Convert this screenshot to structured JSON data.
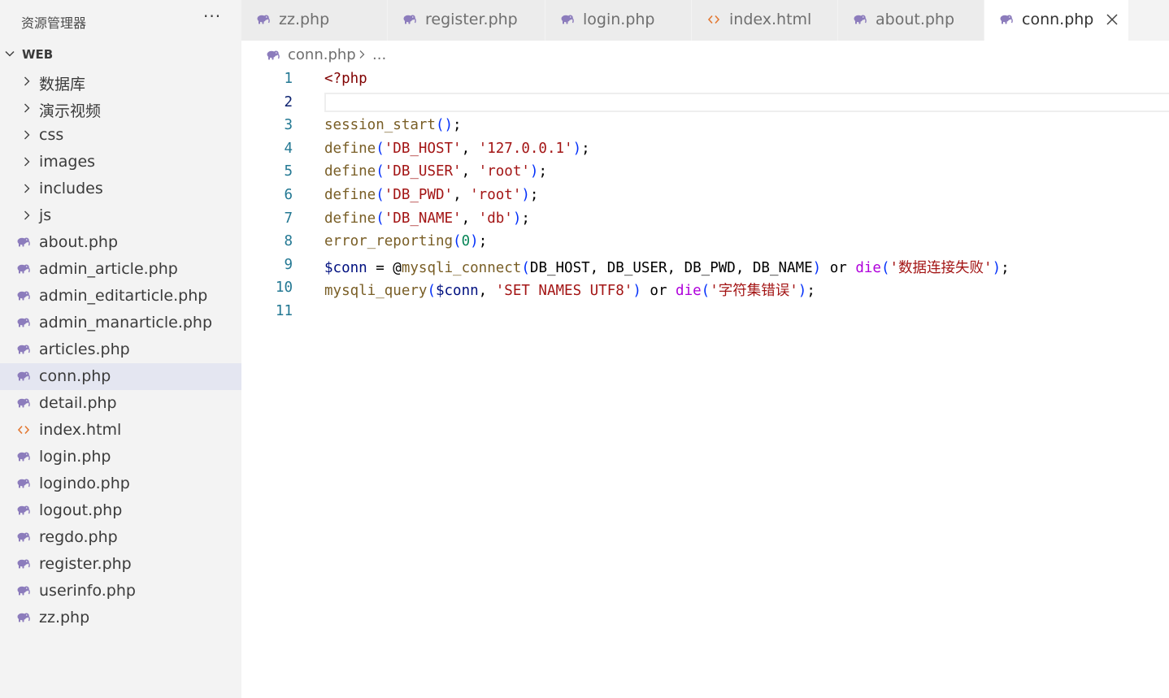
{
  "explorer": {
    "title": "资源管理器",
    "more_label": "···",
    "root": {
      "label": "WEB",
      "expanded": true
    },
    "items": [
      {
        "type": "folder",
        "label": "数据库"
      },
      {
        "type": "folder",
        "label": "演示视频"
      },
      {
        "type": "folder",
        "label": "css"
      },
      {
        "type": "folder",
        "label": "images"
      },
      {
        "type": "folder",
        "label": "includes"
      },
      {
        "type": "folder",
        "label": "js"
      },
      {
        "type": "php",
        "label": "about.php"
      },
      {
        "type": "php",
        "label": "admin_article.php"
      },
      {
        "type": "php",
        "label": "admin_editarticle.php"
      },
      {
        "type": "php",
        "label": "admin_manarticle.php"
      },
      {
        "type": "php",
        "label": "articles.php"
      },
      {
        "type": "php",
        "label": "conn.php",
        "selected": true
      },
      {
        "type": "php",
        "label": "detail.php"
      },
      {
        "type": "html",
        "label": "index.html"
      },
      {
        "type": "php",
        "label": "login.php"
      },
      {
        "type": "php",
        "label": "logindo.php"
      },
      {
        "type": "php",
        "label": "logout.php"
      },
      {
        "type": "php",
        "label": "regdo.php"
      },
      {
        "type": "php",
        "label": "register.php"
      },
      {
        "type": "php",
        "label": "userinfo.php"
      },
      {
        "type": "php",
        "label": "zz.php"
      }
    ]
  },
  "tabs": [
    {
      "label": "zz.php",
      "type": "php"
    },
    {
      "label": "register.php",
      "type": "php"
    },
    {
      "label": "login.php",
      "type": "php"
    },
    {
      "label": "index.html",
      "type": "html"
    },
    {
      "label": "about.php",
      "type": "php"
    },
    {
      "label": "conn.php",
      "type": "php",
      "active": true
    }
  ],
  "breadcrumb": {
    "file": "conn.php",
    "more": "..."
  },
  "editor": {
    "current_line": 2,
    "lines": [
      {
        "n": "1",
        "tokens": [
          [
            "kw",
            "<?php"
          ]
        ]
      },
      {
        "n": "2",
        "tokens": []
      },
      {
        "n": "3",
        "tokens": [
          [
            "fn",
            "session_start"
          ],
          [
            "par",
            "()"
          ],
          [
            "pun",
            ";"
          ]
        ]
      },
      {
        "n": "4",
        "tokens": [
          [
            "fn",
            "define"
          ],
          [
            "par",
            "("
          ],
          [
            "str",
            "'DB_HOST'"
          ],
          [
            "pun",
            ", "
          ],
          [
            "str",
            "'127.0.0.1'"
          ],
          [
            "par",
            ")"
          ],
          [
            "pun",
            ";"
          ]
        ]
      },
      {
        "n": "5",
        "tokens": [
          [
            "fn",
            "define"
          ],
          [
            "par",
            "("
          ],
          [
            "str",
            "'DB_USER'"
          ],
          [
            "pun",
            ", "
          ],
          [
            "str",
            "'root'"
          ],
          [
            "par",
            ")"
          ],
          [
            "pun",
            ";"
          ]
        ]
      },
      {
        "n": "6",
        "tokens": [
          [
            "fn",
            "define"
          ],
          [
            "par",
            "("
          ],
          [
            "str",
            "'DB_PWD'"
          ],
          [
            "pun",
            ", "
          ],
          [
            "str",
            "'root'"
          ],
          [
            "par",
            ")"
          ],
          [
            "pun",
            ";"
          ]
        ]
      },
      {
        "n": "7",
        "tokens": [
          [
            "fn",
            "define"
          ],
          [
            "par",
            "("
          ],
          [
            "str",
            "'DB_NAME'"
          ],
          [
            "pun",
            ", "
          ],
          [
            "str",
            "'db'"
          ],
          [
            "par",
            ")"
          ],
          [
            "pun",
            ";"
          ]
        ]
      },
      {
        "n": "8",
        "tokens": [
          [
            "fn",
            "error_reporting"
          ],
          [
            "par",
            "("
          ],
          [
            "num",
            "0"
          ],
          [
            "par",
            ")"
          ],
          [
            "pun",
            ";"
          ]
        ]
      },
      {
        "n": "9",
        "tokens": [
          [
            "var",
            "$conn"
          ],
          [
            "op",
            " = "
          ],
          [
            "op",
            "@"
          ],
          [
            "fn",
            "mysqli_connect"
          ],
          [
            "par",
            "("
          ],
          [
            "const",
            "DB_HOST"
          ],
          [
            "pun",
            ", "
          ],
          [
            "const",
            "DB_USER"
          ],
          [
            "pun",
            ", "
          ],
          [
            "const",
            "DB_PWD"
          ],
          [
            "pun",
            ", "
          ],
          [
            "const",
            "DB_NAME"
          ],
          [
            "par",
            ")"
          ],
          [
            "op",
            " or "
          ],
          [
            "ctrl",
            "die"
          ],
          [
            "par",
            "("
          ],
          [
            "str",
            "'数据连接失败'"
          ],
          [
            "par",
            ")"
          ],
          [
            "pun",
            ";"
          ]
        ]
      },
      {
        "n": "10",
        "tokens": [
          [
            "fn",
            "mysqli_query"
          ],
          [
            "par",
            "("
          ],
          [
            "var",
            "$conn"
          ],
          [
            "pun",
            ", "
          ],
          [
            "str",
            "'SET NAMES UTF8'"
          ],
          [
            "par",
            ")"
          ],
          [
            "op",
            " or "
          ],
          [
            "ctrl",
            "die"
          ],
          [
            "par",
            "("
          ],
          [
            "str",
            "'字符集错误'"
          ],
          [
            "par",
            ")"
          ],
          [
            "pun",
            ";"
          ]
        ]
      },
      {
        "n": "11",
        "tokens": []
      }
    ]
  },
  "colors": {
    "php_icon": "#8c7cbc",
    "html_icon": "#e37933"
  }
}
